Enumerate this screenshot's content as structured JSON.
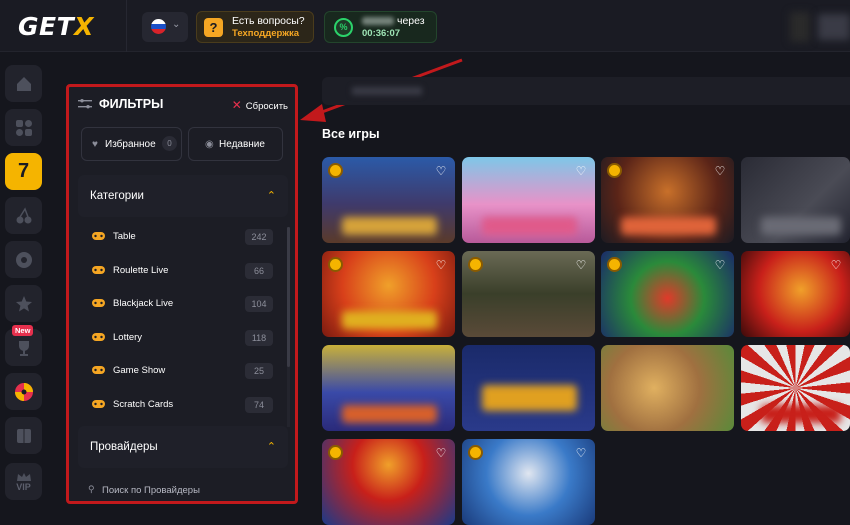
{
  "app": {
    "logo_main": "GET",
    "logo_accent": "X",
    "brand_color": "#f5b400"
  },
  "header": {
    "language_flag": "russia-flag-icon",
    "support": {
      "title": "Есть вопросы?",
      "subtitle": "Техподдержка"
    },
    "cashback": {
      "title_suffix": "через",
      "timer": "00:36:07"
    }
  },
  "left_nav": {
    "items": [
      "home-icon",
      "grid-icon",
      "slots-7-icon",
      "cherries-icon",
      "football-icon",
      "star-icon",
      "trophy-icon",
      "wheel-icon",
      "book-icon",
      "vip-crown-icon"
    ],
    "active_index": 2,
    "new_badge": "New",
    "vip_label": "VIP",
    "slots_glyph": "7"
  },
  "filters": {
    "title": "ФИЛЬТРЫ",
    "reset_label": "Сбросить",
    "favorites_label": "Избранное",
    "favorites_count": "0",
    "recent_label": "Недавние",
    "categories_title": "Категории",
    "categories": [
      {
        "name": "Table",
        "count": "242"
      },
      {
        "name": "Roulette Live",
        "count": "66"
      },
      {
        "name": "Blackjack Live",
        "count": "104"
      },
      {
        "name": "Lottery",
        "count": "118"
      },
      {
        "name": "Game Show",
        "count": "25"
      },
      {
        "name": "Scratch Cards",
        "count": "74"
      }
    ],
    "providers_title": "Провайдеры",
    "providers_search_placeholder": "Поиск по Провайдеры"
  },
  "main": {
    "section_title": "Все игры"
  },
  "colors": {
    "accent": "#f5b400",
    "highlight_frame": "#c2191c",
    "support_accent": "#f5a623",
    "cashback_accent": "#2bd26a"
  }
}
